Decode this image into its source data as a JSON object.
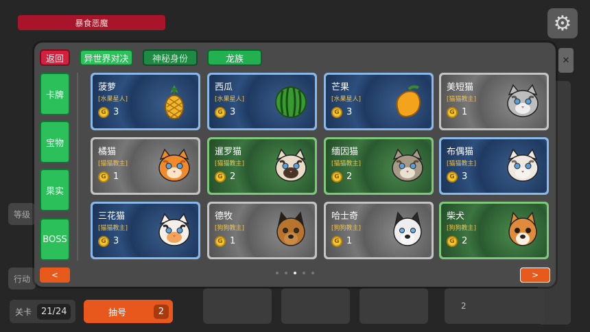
{
  "background": {
    "title": "暴食恶魔",
    "side_labels": [
      "等级",
      "行动"
    ],
    "stage_label": "关卡",
    "stage_value": "21/24",
    "draw_label": "抽号",
    "draw_count": "2",
    "bg_cost": "2"
  },
  "header": {
    "back": "返回",
    "tabs": [
      "异世界对决",
      "神秘身份",
      "龙族"
    ]
  },
  "sidebar": [
    "卡牌",
    "宝物",
    "果实",
    "BOSS"
  ],
  "cards": [
    {
      "name": "菠萝",
      "tag": "[水果星人]",
      "cost": "3",
      "style": "blue",
      "icon": "pineapple-icon"
    },
    {
      "name": "西瓜",
      "tag": "[水果星人]",
      "cost": "3",
      "style": "blue",
      "icon": "watermelon-icon"
    },
    {
      "name": "芒果",
      "tag": "[水果星人]",
      "cost": "3",
      "style": "blue",
      "icon": "mango-icon"
    },
    {
      "name": "美短猫",
      "tag": "[猫猫教主]",
      "cost": "1",
      "style": "gray",
      "icon": "shorthair-cat-icon"
    },
    {
      "name": "橘猫",
      "tag": "[猫猫教主]",
      "cost": "1",
      "style": "gray",
      "icon": "orange-cat-icon"
    },
    {
      "name": "暹罗猫",
      "tag": "[猫猫教主]",
      "cost": "2",
      "style": "green",
      "icon": "siamese-cat-icon"
    },
    {
      "name": "缅因猫",
      "tag": "[猫猫教主]",
      "cost": "2",
      "style": "green",
      "icon": "maine-coon-icon"
    },
    {
      "name": "布偶猫",
      "tag": "[猫猫教主]",
      "cost": "3",
      "style": "blue",
      "icon": "ragdoll-cat-icon"
    },
    {
      "name": "三花猫",
      "tag": "[猫猫教主]",
      "cost": "3",
      "style": "blue",
      "icon": "calico-cat-icon"
    },
    {
      "name": "德牧",
      "tag": "[狗狗教主]",
      "cost": "1",
      "style": "gray",
      "icon": "german-shepherd-icon"
    },
    {
      "name": "哈士奇",
      "tag": "[狗狗教主]",
      "cost": "1",
      "style": "gray",
      "icon": "husky-icon"
    },
    {
      "name": "柴犬",
      "tag": "[狗狗教主]",
      "cost": "2",
      "style": "green",
      "icon": "shiba-icon"
    }
  ],
  "coin_glyph": "G",
  "pager": {
    "pages": 5,
    "active": 2,
    "prev": "<",
    "next": ">"
  },
  "colors": {
    "accent_green": "#2bc05a",
    "accent_red": "#d0213f",
    "accent_orange": "#e85a1c",
    "gold": "#f2c530"
  }
}
